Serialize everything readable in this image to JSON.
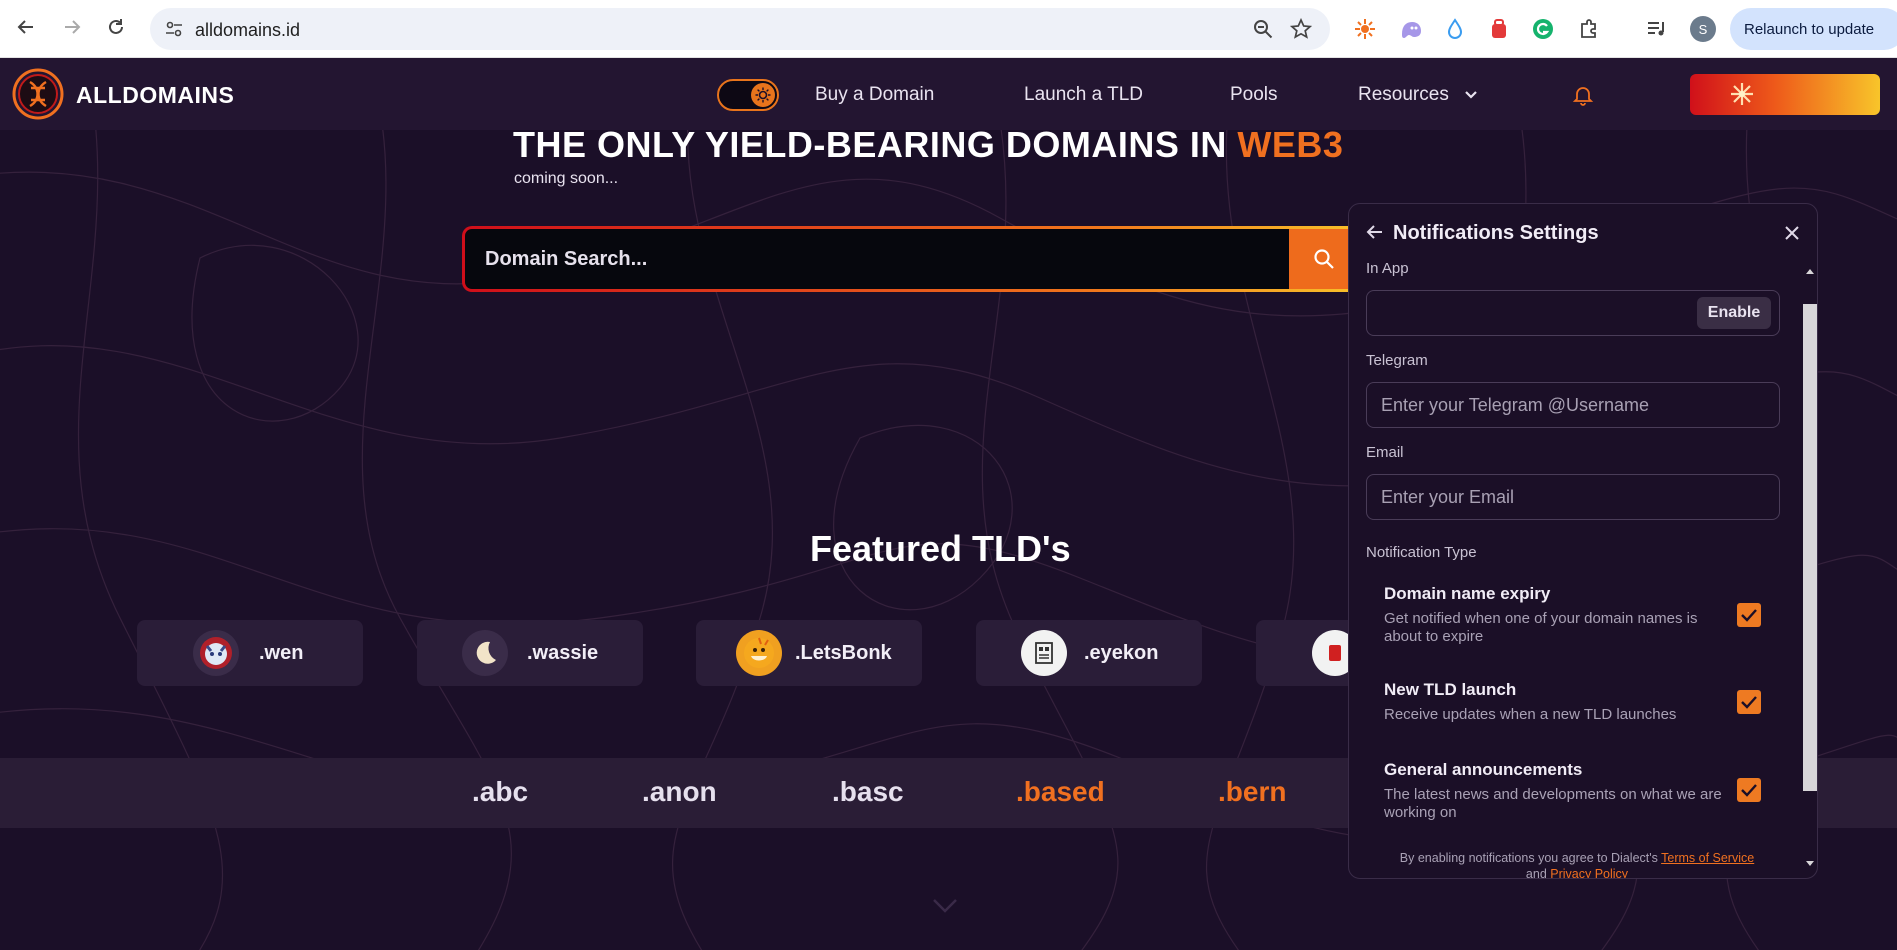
{
  "browser": {
    "url": "alldomains.id",
    "profile_initial": "S",
    "relaunch_label": "Relaunch to update"
  },
  "site": {
    "logo_text": "ALLDOMAINS",
    "nav": {
      "buy": "Buy a Domain",
      "launch": "Launch a TLD",
      "pools": "Pools",
      "resources": "Resources"
    },
    "hero": {
      "title_main": "THE ONLY YIELD-BEARING DOMAINS IN ",
      "title_accent": "WEB3",
      "subtitle": "coming soon..."
    },
    "search": {
      "placeholder": "Domain Search..."
    },
    "featured": {
      "title": "Featured TLD's",
      "cards": [
        ".wen",
        ".wassie",
        ".LetsBonk",
        ".eyekon"
      ]
    },
    "ticker": [
      ".abc",
      ".anon",
      ".basc",
      ".based",
      ".bern"
    ],
    "colors": {
      "accent": "#f07020",
      "background": "#1b0f28"
    }
  },
  "panel": {
    "title": "Notifications Settings",
    "in_app": {
      "label": "In App",
      "button": "Enable"
    },
    "telegram": {
      "label": "Telegram",
      "placeholder": "Enter your Telegram @Username"
    },
    "email": {
      "label": "Email",
      "placeholder": "Enter your Email"
    },
    "types_label": "Notification Type",
    "types": [
      {
        "title": "Domain name expiry",
        "desc": "Get notified when one of your domain names is about to expire",
        "checked": true
      },
      {
        "title": "New TLD launch",
        "desc": "Receive updates when a new TLD launches",
        "checked": true
      },
      {
        "title": "General announcements",
        "desc": "The latest news and developments on what we are working on",
        "checked": true
      }
    ],
    "footer": {
      "prefix": "By enabling notifications you agree to Dialect's ",
      "tos": "Terms of Service",
      "and": "and ",
      "privacy": "Privacy Policy"
    }
  }
}
